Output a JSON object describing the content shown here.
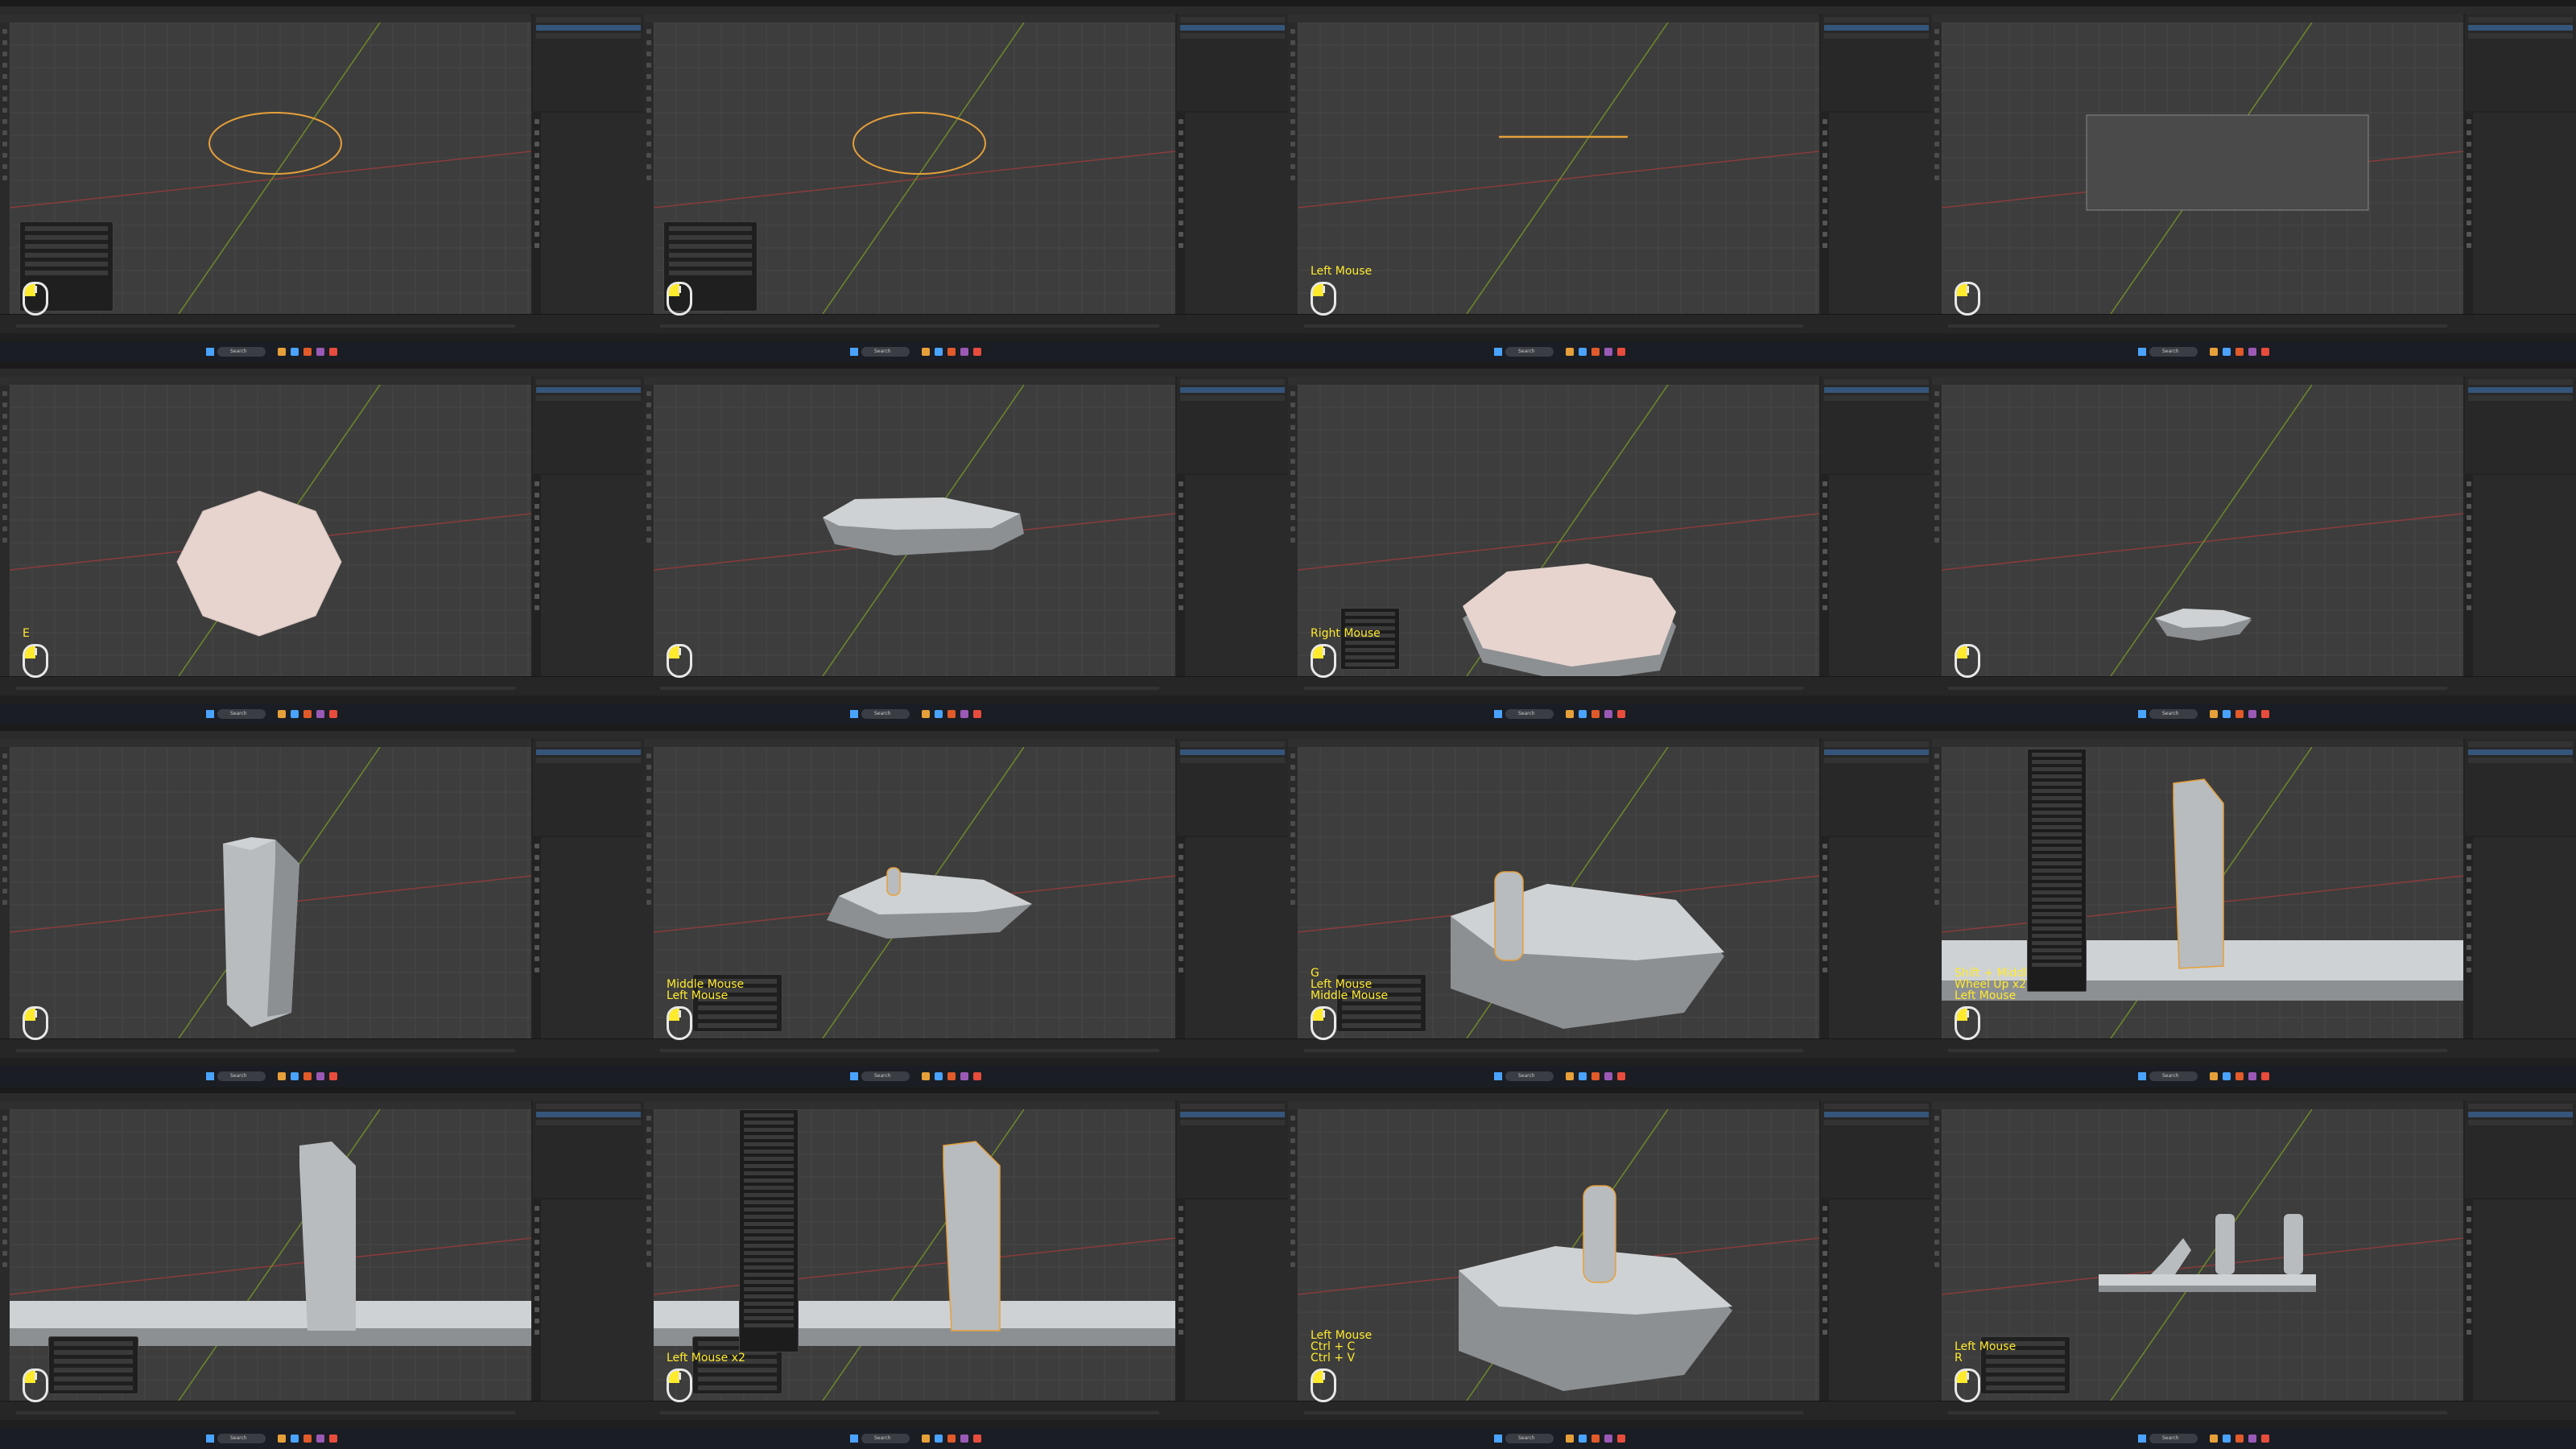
{
  "keystrokes": {
    "p3": "Left Mouse",
    "p5": "E",
    "p7": "Right Mouse",
    "p10": "Middle Mouse\nLeft Mouse",
    "p11": "G\nLeft Mouse\nMiddle Mouse",
    "p12": "Shift + Middl\nWheel Up x2\nLeft Mouse",
    "p14": "Left Mouse x2",
    "p15": "Left Mouse\nCtrl + C\nCtrl + V",
    "p16": "Left Mouse\nR"
  },
  "taskbar": {
    "search": "Search"
  }
}
